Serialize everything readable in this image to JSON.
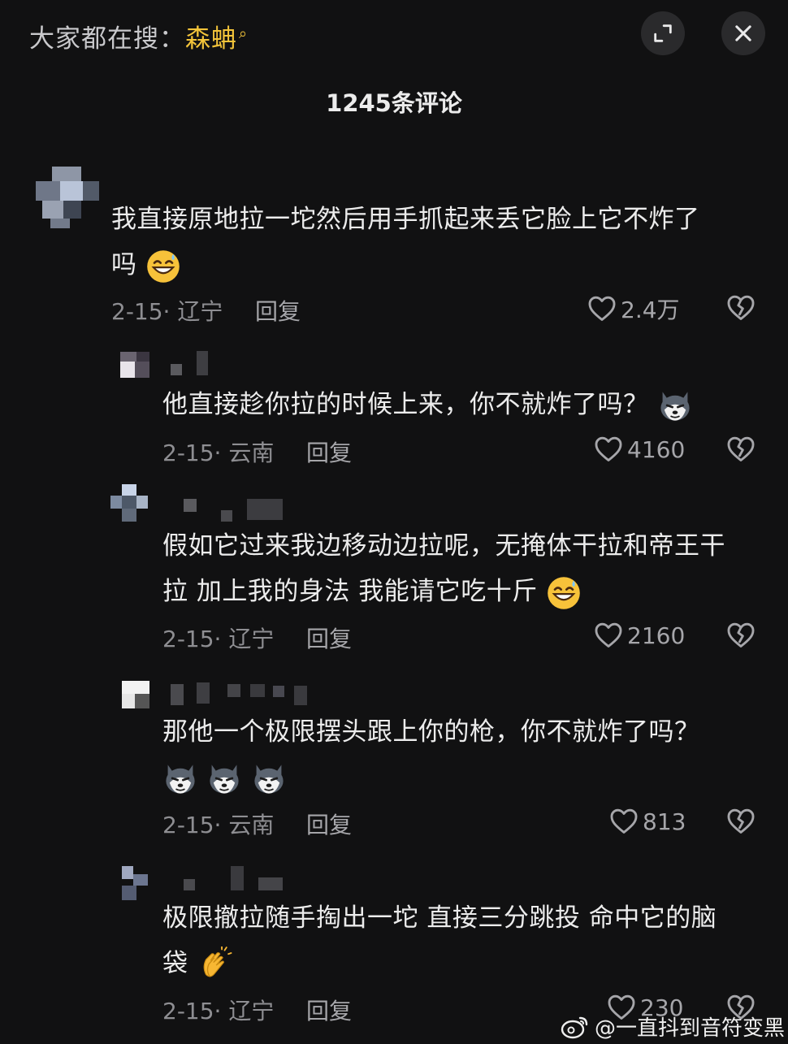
{
  "topbar": {
    "search_prefix": "大家都在搜：",
    "search_keyword": "森蚺",
    "expand_icon": "expand-icon",
    "close_icon": "close-icon"
  },
  "comment_count": "1245条评论",
  "comments": [
    {
      "text_line1": "我直接原地拉一坨然后用手抓起来丢它脸上它不炸了",
      "text_line2": "吗",
      "emoji": "grin-sweat-emoji",
      "date_loc": "2-15· 辽宁",
      "reply": "回复",
      "likes": "2.4万"
    },
    {
      "text_line1": "他直接趁你拉的时候上来，你不就炸了吗？",
      "emoji": "husky-emoji",
      "date_loc": "2-15· 云南",
      "reply": "回复",
      "likes": "4160"
    },
    {
      "text_line1": "假如它过来我边移动边拉呢，无掩体干拉和帝王干",
      "text_line2": "拉 加上我的身法 我能请它吃十斤",
      "emoji": "grin-sweat-emoji",
      "date_loc": "2-15· 辽宁",
      "reply": "回复",
      "likes": "2160"
    },
    {
      "text_line1": "那他一个极限摆头跟上你的枪，你不就炸了吗？",
      "emoji": "husky-emoji",
      "date_loc": "2-15· 云南",
      "reply": "回复",
      "likes": "813"
    },
    {
      "text_line1": "极限撤拉随手掏出一坨 直接三分跳投 命中它的脑",
      "text_line2": "袋",
      "emoji": "clapping-hands-emoji",
      "date_loc": "2-15· 辽宁",
      "reply": "回复",
      "likes": "230"
    }
  ],
  "watermark": "@一直抖到音符变黑"
}
